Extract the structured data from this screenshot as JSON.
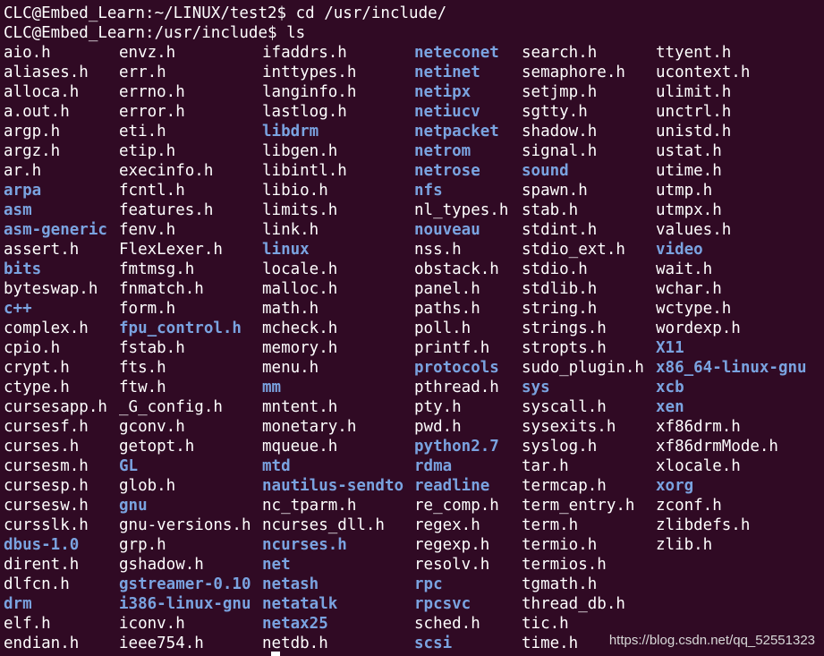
{
  "terminal": {
    "lines": [
      "CLC@Embed_Learn:~/LINUX/test2$ cd /usr/include/",
      "CLC@Embed_Learn:/usr/include$ ls"
    ],
    "columns": [
      [
        {
          "name": "aio.h",
          "dir": false
        },
        {
          "name": "aliases.h",
          "dir": false
        },
        {
          "name": "alloca.h",
          "dir": false
        },
        {
          "name": "a.out.h",
          "dir": false
        },
        {
          "name": "argp.h",
          "dir": false
        },
        {
          "name": "argz.h",
          "dir": false
        },
        {
          "name": "ar.h",
          "dir": false
        },
        {
          "name": "arpa",
          "dir": true
        },
        {
          "name": "asm",
          "dir": true
        },
        {
          "name": "asm-generic",
          "dir": true
        },
        {
          "name": "assert.h",
          "dir": false
        },
        {
          "name": "bits",
          "dir": true
        },
        {
          "name": "byteswap.h",
          "dir": false
        },
        {
          "name": "c++",
          "dir": true
        },
        {
          "name": "complex.h",
          "dir": false
        },
        {
          "name": "cpio.h",
          "dir": false
        },
        {
          "name": "crypt.h",
          "dir": false
        },
        {
          "name": "ctype.h",
          "dir": false
        },
        {
          "name": "cursesapp.h",
          "dir": false
        },
        {
          "name": "cursesf.h",
          "dir": false
        },
        {
          "name": "curses.h",
          "dir": false
        },
        {
          "name": "cursesm.h",
          "dir": false
        },
        {
          "name": "cursesp.h",
          "dir": false
        },
        {
          "name": "cursesw.h",
          "dir": false
        },
        {
          "name": "cursslk.h",
          "dir": false
        },
        {
          "name": "dbus-1.0",
          "dir": true
        },
        {
          "name": "dirent.h",
          "dir": false
        },
        {
          "name": "dlfcn.h",
          "dir": false
        },
        {
          "name": "drm",
          "dir": true
        },
        {
          "name": "elf.h",
          "dir": false
        },
        {
          "name": "endian.h",
          "dir": false
        }
      ],
      [
        {
          "name": "envz.h",
          "dir": false
        },
        {
          "name": "err.h",
          "dir": false
        },
        {
          "name": "errno.h",
          "dir": false
        },
        {
          "name": "error.h",
          "dir": false
        },
        {
          "name": "eti.h",
          "dir": false
        },
        {
          "name": "etip.h",
          "dir": false
        },
        {
          "name": "execinfo.h",
          "dir": false
        },
        {
          "name": "fcntl.h",
          "dir": false
        },
        {
          "name": "features.h",
          "dir": false
        },
        {
          "name": "fenv.h",
          "dir": false
        },
        {
          "name": "FlexLexer.h",
          "dir": false
        },
        {
          "name": "fmtmsg.h",
          "dir": false
        },
        {
          "name": "fnmatch.h",
          "dir": false
        },
        {
          "name": "form.h",
          "dir": false
        },
        {
          "name": "fpu_control.h",
          "dir": true
        },
        {
          "name": "fstab.h",
          "dir": false
        },
        {
          "name": "fts.h",
          "dir": false
        },
        {
          "name": "ftw.h",
          "dir": false
        },
        {
          "name": "_G_config.h",
          "dir": false
        },
        {
          "name": "gconv.h",
          "dir": false
        },
        {
          "name": "getopt.h",
          "dir": false
        },
        {
          "name": "GL",
          "dir": true
        },
        {
          "name": "glob.h",
          "dir": false
        },
        {
          "name": "gnu",
          "dir": true
        },
        {
          "name": "gnu-versions.h",
          "dir": false
        },
        {
          "name": "grp.h",
          "dir": false
        },
        {
          "name": "gshadow.h",
          "dir": false
        },
        {
          "name": "gstreamer-0.10",
          "dir": true
        },
        {
          "name": "i386-linux-gnu",
          "dir": true
        },
        {
          "name": "iconv.h",
          "dir": false
        },
        {
          "name": "ieee754.h",
          "dir": false
        }
      ],
      [
        {
          "name": "ifaddrs.h",
          "dir": false
        },
        {
          "name": "inttypes.h",
          "dir": false
        },
        {
          "name": "langinfo.h",
          "dir": false
        },
        {
          "name": "lastlog.h",
          "dir": false
        },
        {
          "name": "libdrm",
          "dir": true
        },
        {
          "name": "libgen.h",
          "dir": false
        },
        {
          "name": "libintl.h",
          "dir": false
        },
        {
          "name": "libio.h",
          "dir": false
        },
        {
          "name": "limits.h",
          "dir": false
        },
        {
          "name": "link.h",
          "dir": false
        },
        {
          "name": "linux",
          "dir": true
        },
        {
          "name": "locale.h",
          "dir": false
        },
        {
          "name": "malloc.h",
          "dir": false
        },
        {
          "name": "math.h",
          "dir": false
        },
        {
          "name": "mcheck.h",
          "dir": false
        },
        {
          "name": "memory.h",
          "dir": false
        },
        {
          "name": "menu.h",
          "dir": false
        },
        {
          "name": "mm",
          "dir": true
        },
        {
          "name": "mntent.h",
          "dir": false
        },
        {
          "name": "monetary.h",
          "dir": false
        },
        {
          "name": "mqueue.h",
          "dir": false
        },
        {
          "name": "mtd",
          "dir": true
        },
        {
          "name": "nautilus-sendto",
          "dir": true
        },
        {
          "name": "nc_tparm.h",
          "dir": false
        },
        {
          "name": "ncurses_dll.h",
          "dir": false
        },
        {
          "name": "ncurses.h",
          "dir": true
        },
        {
          "name": "net",
          "dir": true
        },
        {
          "name": "netash",
          "dir": true
        },
        {
          "name": "netatalk",
          "dir": true
        },
        {
          "name": "netax25",
          "dir": true
        },
        {
          "name": "netdb.h",
          "dir": false
        }
      ],
      [
        {
          "name": "neteconet",
          "dir": true
        },
        {
          "name": "netinet",
          "dir": true
        },
        {
          "name": "netipx",
          "dir": true
        },
        {
          "name": "netiucv",
          "dir": true
        },
        {
          "name": "netpacket",
          "dir": true
        },
        {
          "name": "netrom",
          "dir": true
        },
        {
          "name": "netrose",
          "dir": true
        },
        {
          "name": "nfs",
          "dir": true
        },
        {
          "name": "nl_types.h",
          "dir": false
        },
        {
          "name": "nouveau",
          "dir": true
        },
        {
          "name": "nss.h",
          "dir": false
        },
        {
          "name": "obstack.h",
          "dir": false
        },
        {
          "name": "panel.h",
          "dir": false
        },
        {
          "name": "paths.h",
          "dir": false
        },
        {
          "name": "poll.h",
          "dir": false
        },
        {
          "name": "printf.h",
          "dir": false
        },
        {
          "name": "protocols",
          "dir": true
        },
        {
          "name": "pthread.h",
          "dir": false
        },
        {
          "name": "pty.h",
          "dir": false
        },
        {
          "name": "pwd.h",
          "dir": false
        },
        {
          "name": "python2.7",
          "dir": true
        },
        {
          "name": "rdma",
          "dir": true
        },
        {
          "name": "readline",
          "dir": true
        },
        {
          "name": "re_comp.h",
          "dir": false
        },
        {
          "name": "regex.h",
          "dir": false
        },
        {
          "name": "regexp.h",
          "dir": false
        },
        {
          "name": "resolv.h",
          "dir": false
        },
        {
          "name": "rpc",
          "dir": true
        },
        {
          "name": "rpcsvc",
          "dir": true
        },
        {
          "name": "sched.h",
          "dir": false
        },
        {
          "name": "scsi",
          "dir": true
        }
      ],
      [
        {
          "name": "search.h",
          "dir": false
        },
        {
          "name": "semaphore.h",
          "dir": false
        },
        {
          "name": "setjmp.h",
          "dir": false
        },
        {
          "name": "sgtty.h",
          "dir": false
        },
        {
          "name": "shadow.h",
          "dir": false
        },
        {
          "name": "signal.h",
          "dir": false
        },
        {
          "name": "sound",
          "dir": true
        },
        {
          "name": "spawn.h",
          "dir": false
        },
        {
          "name": "stab.h",
          "dir": false
        },
        {
          "name": "stdint.h",
          "dir": false
        },
        {
          "name": "stdio_ext.h",
          "dir": false
        },
        {
          "name": "stdio.h",
          "dir": false
        },
        {
          "name": "stdlib.h",
          "dir": false
        },
        {
          "name": "string.h",
          "dir": false
        },
        {
          "name": "strings.h",
          "dir": false
        },
        {
          "name": "stropts.h",
          "dir": false
        },
        {
          "name": "sudo_plugin.h",
          "dir": false
        },
        {
          "name": "sys",
          "dir": true
        },
        {
          "name": "syscall.h",
          "dir": false
        },
        {
          "name": "sysexits.h",
          "dir": false
        },
        {
          "name": "syslog.h",
          "dir": false
        },
        {
          "name": "tar.h",
          "dir": false
        },
        {
          "name": "termcap.h",
          "dir": false
        },
        {
          "name": "term_entry.h",
          "dir": false
        },
        {
          "name": "term.h",
          "dir": false
        },
        {
          "name": "termio.h",
          "dir": false
        },
        {
          "name": "termios.h",
          "dir": false
        },
        {
          "name": "tgmath.h",
          "dir": false
        },
        {
          "name": "thread_db.h",
          "dir": false
        },
        {
          "name": "tic.h",
          "dir": false
        },
        {
          "name": "time.h",
          "dir": false
        }
      ],
      [
        {
          "name": "ttyent.h",
          "dir": false
        },
        {
          "name": "ucontext.h",
          "dir": false
        },
        {
          "name": "ulimit.h",
          "dir": false
        },
        {
          "name": "unctrl.h",
          "dir": false
        },
        {
          "name": "unistd.h",
          "dir": false
        },
        {
          "name": "ustat.h",
          "dir": false
        },
        {
          "name": "utime.h",
          "dir": false
        },
        {
          "name": "utmp.h",
          "dir": false
        },
        {
          "name": "utmpx.h",
          "dir": false
        },
        {
          "name": "values.h",
          "dir": false
        },
        {
          "name": "video",
          "dir": true
        },
        {
          "name": "wait.h",
          "dir": false
        },
        {
          "name": "wchar.h",
          "dir": false
        },
        {
          "name": "wctype.h",
          "dir": false
        },
        {
          "name": "wordexp.h",
          "dir": false
        },
        {
          "name": "X11",
          "dir": true
        },
        {
          "name": "x86_64-linux-gnu",
          "dir": true
        },
        {
          "name": "xcb",
          "dir": true
        },
        {
          "name": "xen",
          "dir": true
        },
        {
          "name": "xf86drm.h",
          "dir": false
        },
        {
          "name": "xf86drmMode.h",
          "dir": false
        },
        {
          "name": "xlocale.h",
          "dir": false
        },
        {
          "name": "xorg",
          "dir": true
        },
        {
          "name": "zconf.h",
          "dir": false
        },
        {
          "name": "zlibdefs.h",
          "dir": false
        },
        {
          "name": "zlib.h",
          "dir": false
        }
      ]
    ],
    "watermark": "https://blog.csdn.net/qq_52551323"
  },
  "colors": {
    "background": "#300a24",
    "text": "#ffffff",
    "directory": "#7aa3e0"
  }
}
